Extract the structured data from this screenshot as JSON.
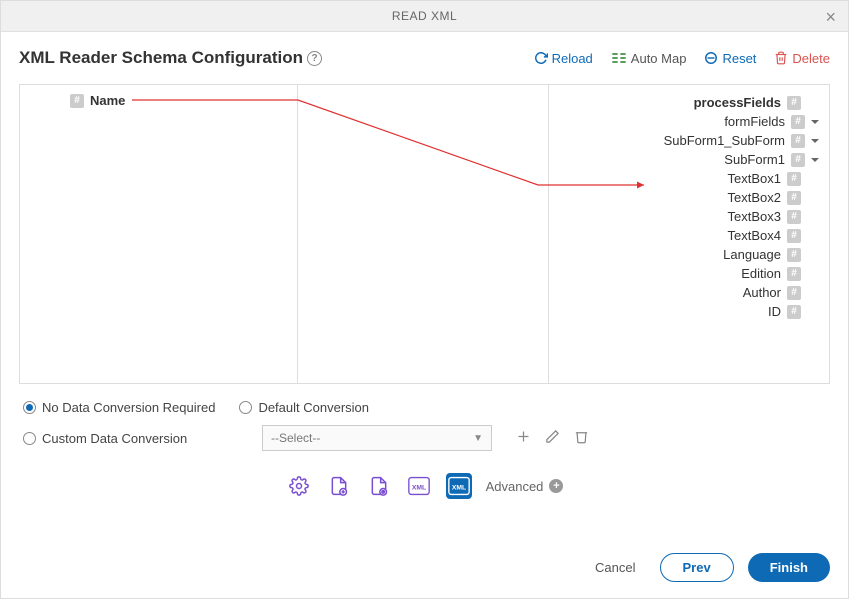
{
  "dialog": {
    "title": "READ XML"
  },
  "heading": "XML Reader Schema Configuration",
  "actions": {
    "reload": "Reload",
    "automap": "Auto Map",
    "reset": "Reset",
    "delete": "Delete"
  },
  "left_field": "Name",
  "right_tree": {
    "processFields": "processFields",
    "formFields": "formFields",
    "subform1_subform": "SubForm1_SubForm",
    "subform1": "SubForm1",
    "textbox1": "TextBox1",
    "textbox2": "TextBox2",
    "textbox3": "TextBox3",
    "textbox4": "TextBox4",
    "language": "Language",
    "edition": "Edition",
    "author": "Author",
    "id": "ID"
  },
  "conversion": {
    "no_conv": "No Data Conversion Required",
    "default_conv": "Default Conversion",
    "custom_conv": "Custom Data Conversion",
    "select_placeholder": "--Select--"
  },
  "advanced": "Advanced",
  "footer": {
    "cancel": "Cancel",
    "prev": "Prev",
    "finish": "Finish"
  }
}
